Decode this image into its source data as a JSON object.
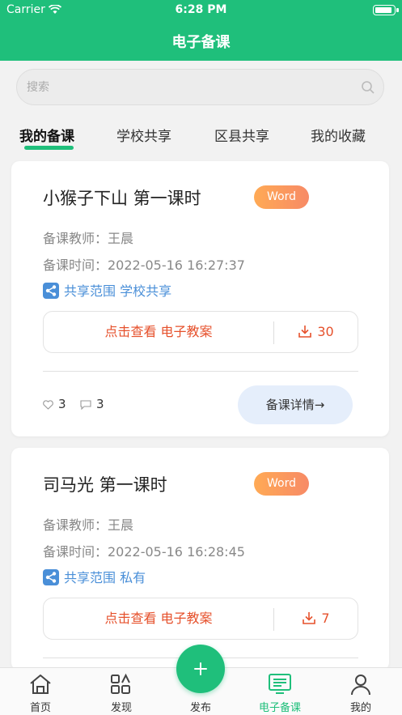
{
  "status": {
    "carrier": "Carrier",
    "time": "6:28 PM"
  },
  "header": {
    "title": "电子备课"
  },
  "search": {
    "placeholder": "搜索"
  },
  "tabs": [
    {
      "label": "我的备课",
      "active": true
    },
    {
      "label": "学校共享",
      "active": false
    },
    {
      "label": "区县共享",
      "active": false
    },
    {
      "label": "我的收藏",
      "active": false
    }
  ],
  "cards": [
    {
      "title": "小猴子下山 第一课时",
      "badge": "Word",
      "teacher": "备课教师：王晨",
      "time": "备课时间：2022-05-16 16:27:37",
      "share": "共享范围 学校共享",
      "view_label": "点击查看 电子教案",
      "downloads": "30",
      "likes": "3",
      "comments": "3",
      "detail_label": "备课详情→"
    },
    {
      "title": "司马光 第一课时",
      "badge": "Word",
      "teacher": "备课教师：王晨",
      "time": "备课时间：2022-05-16 16:28:45",
      "share": "共享范围 私有",
      "view_label": "点击查看 电子教案",
      "downloads": "7"
    }
  ],
  "nav": [
    {
      "label": "首页",
      "icon": "home-icon"
    },
    {
      "label": "发现",
      "icon": "grid-icon"
    },
    {
      "label": "发布",
      "icon": "plus-icon"
    },
    {
      "label": "电子备课",
      "icon": "lesson-icon",
      "active": true
    },
    {
      "label": "我的",
      "icon": "user-icon"
    }
  ],
  "colors": {
    "accent": "#1fbf7b",
    "link": "#4a8fd8",
    "action": "#e6512c"
  }
}
